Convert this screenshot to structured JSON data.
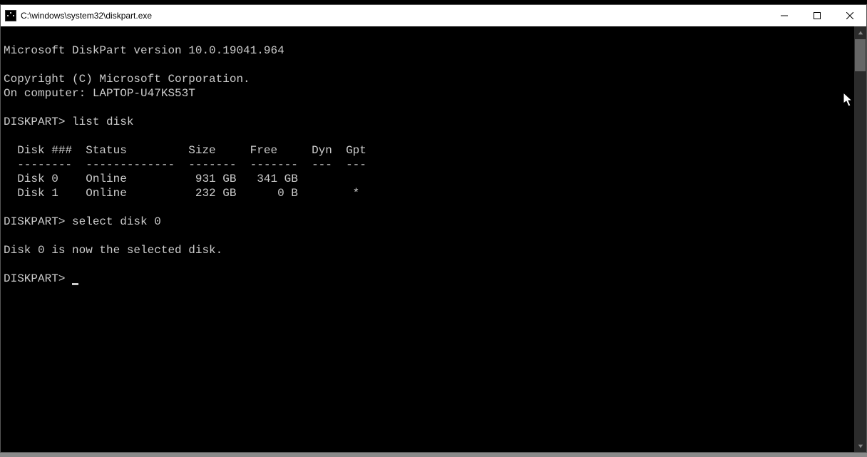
{
  "titlebar": {
    "title": "C:\\windows\\system32\\diskpart.exe"
  },
  "console": {
    "lines": [
      "",
      "Microsoft DiskPart version 10.0.19041.964",
      "",
      "Copyright (C) Microsoft Corporation.",
      "On computer: LAPTOP-U47KS53T",
      "",
      "DISKPART> list disk",
      "",
      "  Disk ###  Status         Size     Free     Dyn  Gpt",
      "  --------  -------------  -------  -------  ---  ---",
      "  Disk 0    Online          931 GB   341 GB",
      "  Disk 1    Online          232 GB      0 B        *",
      "",
      "DISKPART> select disk 0",
      "",
      "Disk 0 is now the selected disk.",
      "",
      "DISKPART> "
    ]
  }
}
